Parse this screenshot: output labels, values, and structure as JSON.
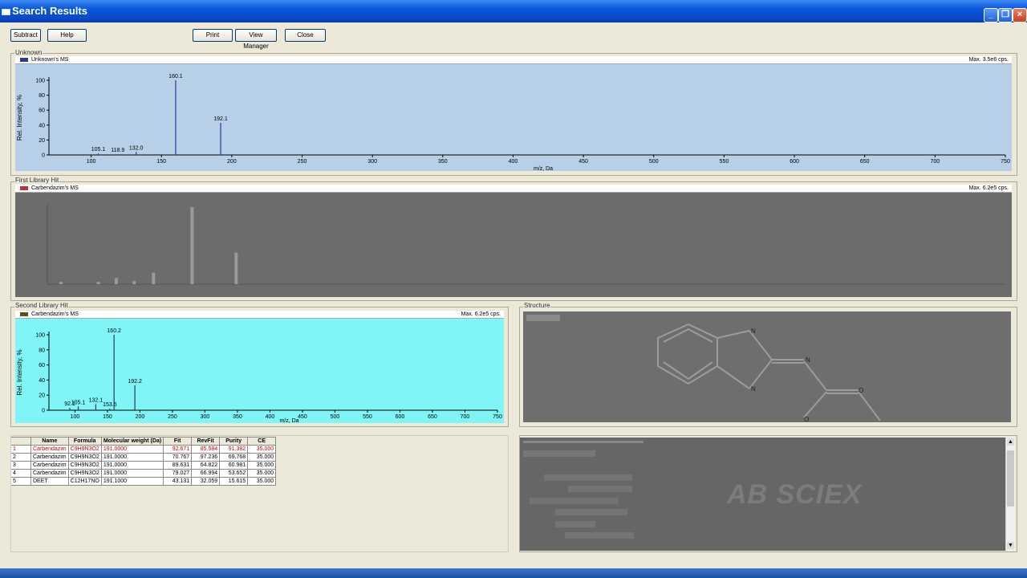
{
  "window": {
    "title": "Search Results"
  },
  "toolbar": {
    "subtract": "Subtract",
    "help": "Help",
    "print": "Print",
    "view_manager": "View Manager",
    "close": "Close"
  },
  "unknown": {
    "group_label": "Unknown",
    "legend": "Unknown's MS",
    "max": "Max. 3.5e6 cps.",
    "ylabel": "Rel. Intensity, %",
    "xlabel": "m/z, Da"
  },
  "first_hit": {
    "group_label": "First Library Hit",
    "legend": "Carbendazim's MS",
    "max": "Max. 6.2e5 cps."
  },
  "second_hit": {
    "group_label": "Second Library Hit",
    "legend": "Carbendazim's MS",
    "max": "Max. 6.2e5 cps.",
    "ylabel": "Rel. Intensity, %",
    "xlabel": "m/z, Da"
  },
  "structure": {
    "group_label": "Structure",
    "atoms": [
      "N",
      "N",
      "N",
      "O",
      "O"
    ]
  },
  "results_table": {
    "headers": [
      "",
      "Name",
      "Formula",
      "Molecular weight (Da)",
      "Fit",
      "RevFit",
      "Purity",
      "CE"
    ],
    "rows": [
      [
        "1",
        "Carbendazim",
        "C9H9N3O2",
        "191.0000",
        "92.671",
        "85.584",
        "91.382",
        "35.000"
      ],
      [
        "2",
        "Carbendazim",
        "C9H9N3O2",
        "191.0000",
        "70.767",
        "97.236",
        "69.768",
        "35.000"
      ],
      [
        "3",
        "Carbendazim",
        "C9H9N3O2",
        "191.0000",
        "89.631",
        "64.822",
        "60.981",
        "35.000"
      ],
      [
        "4",
        "Carbendazim",
        "C9H9N3O2",
        "191.0000",
        "79.027",
        "66.994",
        "53.652",
        "35.000"
      ],
      [
        "5",
        "DEET",
        "C12H17NO",
        "191.1000",
        "43.131",
        "32.059",
        "15.615",
        "35.000"
      ]
    ]
  },
  "logo": {
    "text": "AB SCIEX"
  },
  "chart_data": [
    {
      "type": "bar",
      "name": "unknown",
      "x": [
        105.1,
        118.9,
        132.0,
        160.1,
        192.1
      ],
      "values": [
        2,
        1,
        4,
        100,
        43
      ],
      "peak_labels": [
        "105.1",
        "118.9",
        "132.0",
        "160.1",
        "192.1"
      ],
      "xlabel": "m/z, Da",
      "ylabel": "Rel. Intensity, %",
      "xlim": [
        70,
        750
      ],
      "ylim": [
        0,
        100
      ],
      "xticks": [
        100,
        150,
        200,
        250,
        300,
        350,
        400,
        450,
        500,
        550,
        600,
        650,
        700,
        750
      ],
      "yticks": [
        0,
        20,
        40,
        60,
        80,
        100
      ],
      "color": "#2b3d8f",
      "background": "#b8cfe8"
    },
    {
      "type": "bar",
      "name": "first_library_hit",
      "x": [
        65,
        92,
        105,
        118,
        132,
        160,
        192
      ],
      "values": [
        3,
        3,
        8,
        4,
        15,
        100,
        41
      ],
      "xlim": [
        55,
        750
      ],
      "ylim": [
        0,
        100
      ],
      "color": "#9a9a9a",
      "background": "#6c6c6c"
    },
    {
      "type": "bar",
      "name": "second_library_hit",
      "x": [
        92.1,
        105.1,
        132.1,
        153.6,
        160.2,
        192.2
      ],
      "values": [
        3,
        5,
        8,
        2,
        100,
        33
      ],
      "peak_labels": [
        "92.1",
        "105.1",
        "132.1",
        "153.6",
        "160.2",
        "192.2"
      ],
      "xlabel": "m/z, Da",
      "ylabel": "Rel. Intensity, %",
      "xlim": [
        60,
        750
      ],
      "ylim": [
        0,
        100
      ],
      "xticks": [
        100,
        150,
        200,
        250,
        300,
        350,
        400,
        450,
        500,
        550,
        600,
        650,
        700,
        750
      ],
      "yticks": [
        0,
        20,
        40,
        60,
        80,
        100
      ],
      "color": "#333366",
      "background": "#7ff5f8"
    }
  ]
}
